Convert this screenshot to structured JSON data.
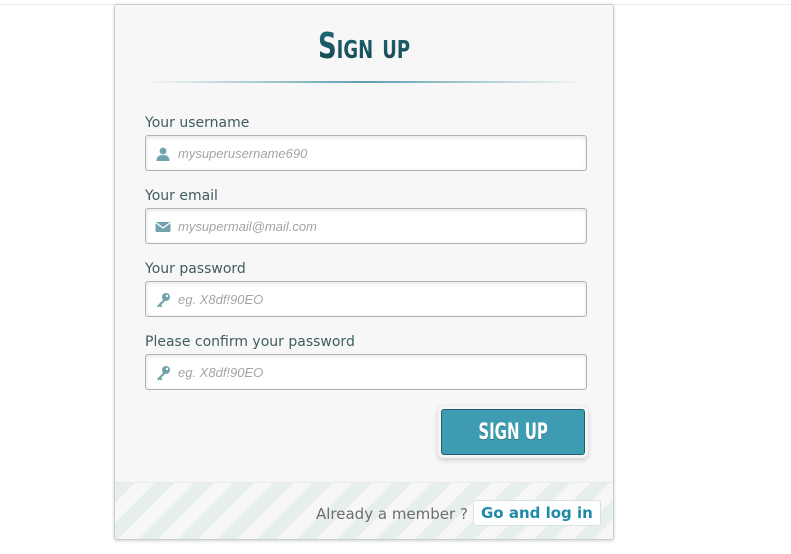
{
  "form": {
    "title": "Sign up",
    "fields": [
      {
        "label": "Your username",
        "placeholder": "mysuperusername690",
        "icon": "user-icon"
      },
      {
        "label": "Your email",
        "placeholder": "mysupermail@mail.com",
        "icon": "envelope-icon"
      },
      {
        "label": "Your password",
        "placeholder": "eg. X8df!90EO",
        "icon": "key-icon"
      },
      {
        "label": "Please confirm your password",
        "placeholder": "eg. X8df!90EO",
        "icon": "key-icon"
      }
    ],
    "submit_label": "SIGN UP"
  },
  "footer": {
    "prompt": "Already a member ?",
    "link_label": "Go and log in"
  },
  "colors": {
    "accent": "#3d9bb2",
    "title": "#1a5866",
    "link": "#1f8aa8",
    "icon": "#6fa2ad"
  }
}
